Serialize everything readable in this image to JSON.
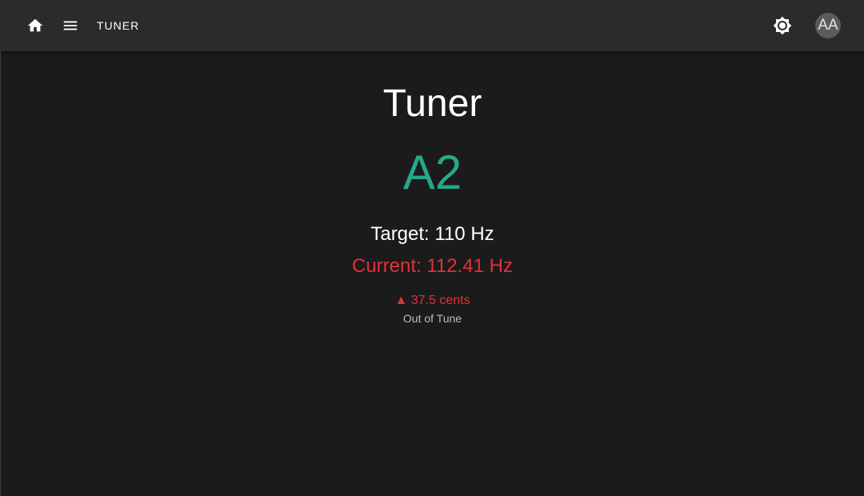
{
  "header": {
    "home_icon": "home-icon",
    "menu_icon": "menu-icon",
    "title": "TUNER",
    "theme_icon": "brightness-icon",
    "avatar_initials": "AA"
  },
  "tuner": {
    "heading": "Tuner",
    "note": "A2",
    "target_label": "Target: 110 Hz",
    "current_label": "Current: 112.41 Hz",
    "direction_glyph": "▲",
    "cents_label": "37.5 cents",
    "status": "Out of Tune"
  },
  "colors": {
    "note": "#26a98a",
    "out_of_tune": "#e0313d",
    "toolbar": "#2b2b2b",
    "background": "#1b1b1b"
  }
}
